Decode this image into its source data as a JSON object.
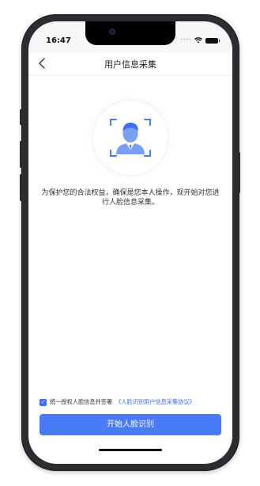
{
  "status": {
    "time": "16:47"
  },
  "nav": {
    "back_icon": "chevron-left-icon",
    "title": "用户信息采集"
  },
  "face_illustration": {
    "icon": "face-scan-icon",
    "accent_color": "#4a7bf7"
  },
  "notice": {
    "text": "为保护您的合法权益，确保是您本人操作，现开始对您进行人脸信息采集。"
  },
  "agreement": {
    "checked": true,
    "prefix": "统一授权人脸信息并签署",
    "link": "《人脸识别用户信息采集协议》"
  },
  "start_button": {
    "label": "开始人脸识别",
    "color": "#4a7bf7"
  }
}
